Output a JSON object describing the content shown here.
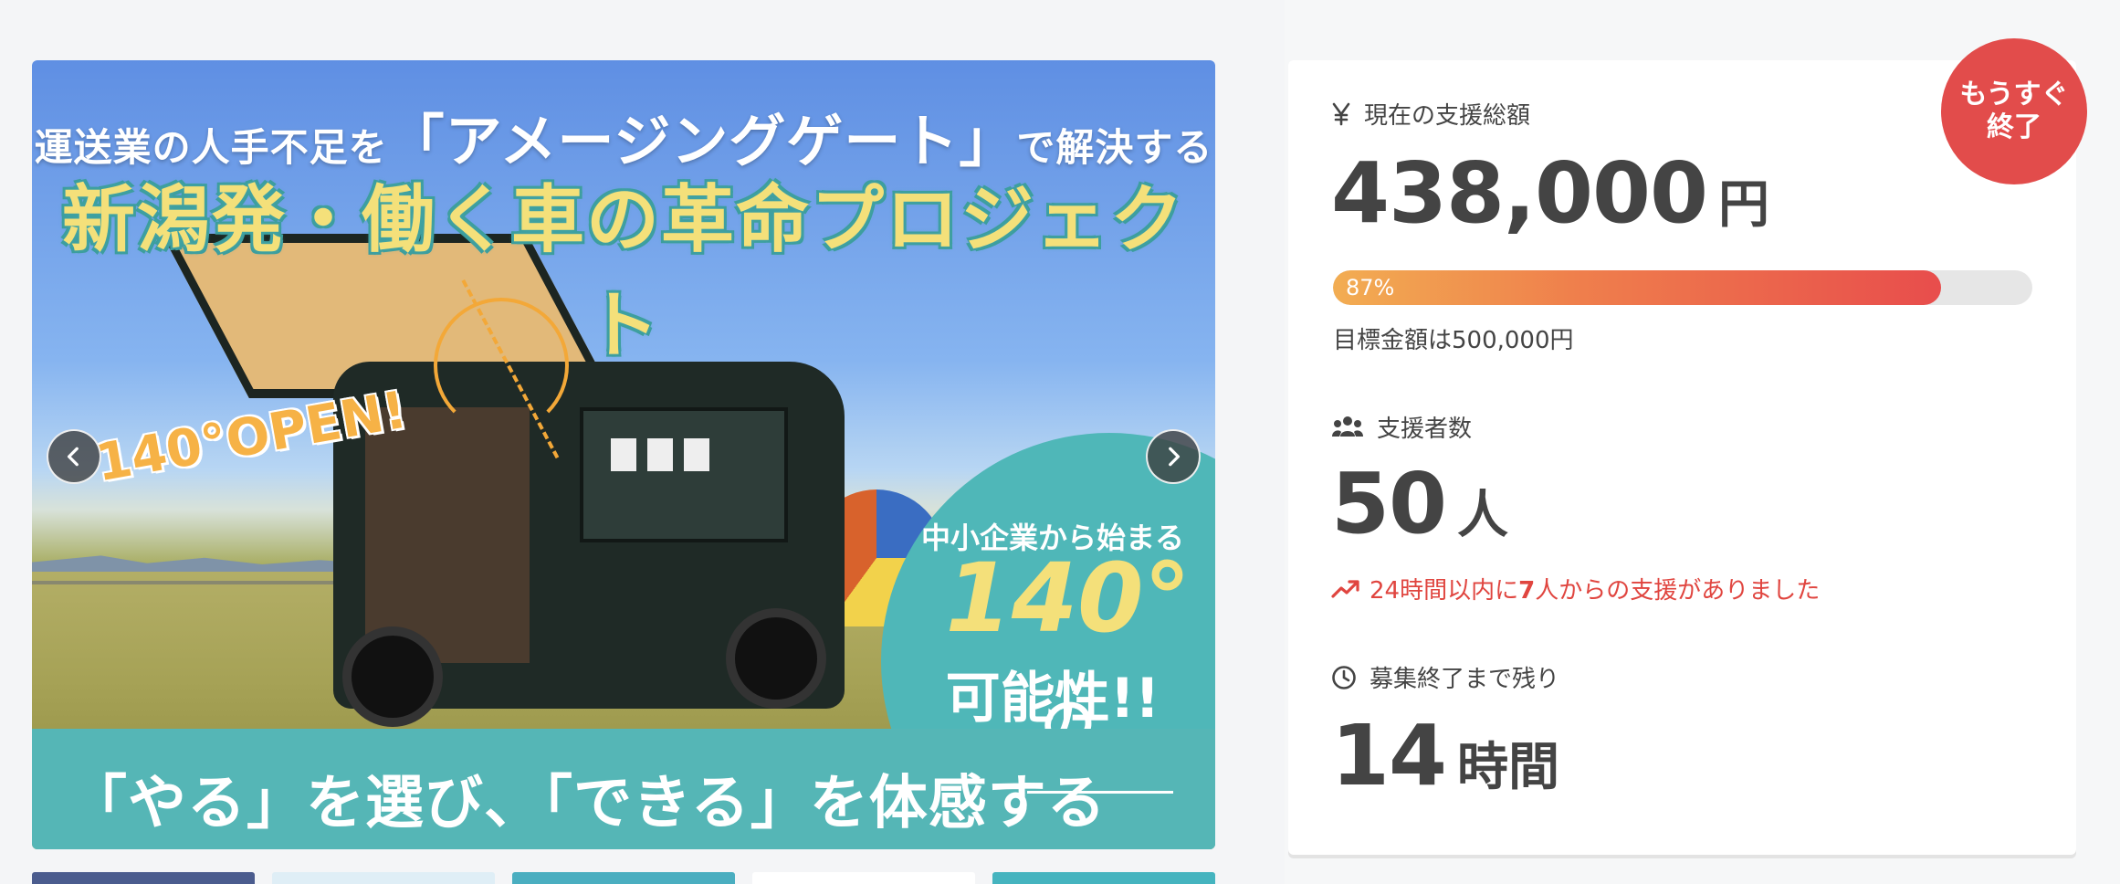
{
  "hero": {
    "headline_pre": "運送業の人手不足を",
    "headline_brand": "「アメージングゲート」",
    "headline_post": "で解決する",
    "title": "新潟発・働く車の革命プロジェクト",
    "open_label": "140°OPEN!",
    "circle_line1": "中小企業から始まる",
    "circle_line2": "140°",
    "circle_line2_suffix": "の",
    "circle_line3": "可能性!!",
    "band_text": "「やる」を選び、「できる」を体感する",
    "prev_icon": "chevron-left-icon",
    "next_icon": "chevron-right-icon"
  },
  "thumbnails": [
    {
      "color": "#4b5c8e"
    },
    {
      "color": "#dfeef6"
    },
    {
      "color": "#4aaec0"
    },
    {
      "color": "#ffffff"
    },
    {
      "color": "#45b4bf"
    }
  ],
  "badge": {
    "line1": "もうすぐ",
    "line2": "終了"
  },
  "funding": {
    "icon": "yen-icon",
    "label": "現在の支援総額",
    "amount": "438,000",
    "unit": "円",
    "progress_percent": 87,
    "progress_label": "87%",
    "goal_text": "目標金額は500,000円"
  },
  "backers": {
    "icon": "users-icon",
    "label": "支援者数",
    "count": "50",
    "unit": "人",
    "trend_icon": "trending-up-icon",
    "trend_prefix": "24時間以内に",
    "trend_count": "7",
    "trend_suffix": "人からの支援がありました"
  },
  "remaining": {
    "icon": "clock-icon",
    "label": "募集終了まで残り",
    "value": "14",
    "unit": "時間"
  },
  "colors": {
    "accent_red": "#e24c4b",
    "progress_start": "#f2ad52",
    "progress_end": "#e84d4c",
    "teal": "#55b6b6",
    "text": "#444444"
  }
}
